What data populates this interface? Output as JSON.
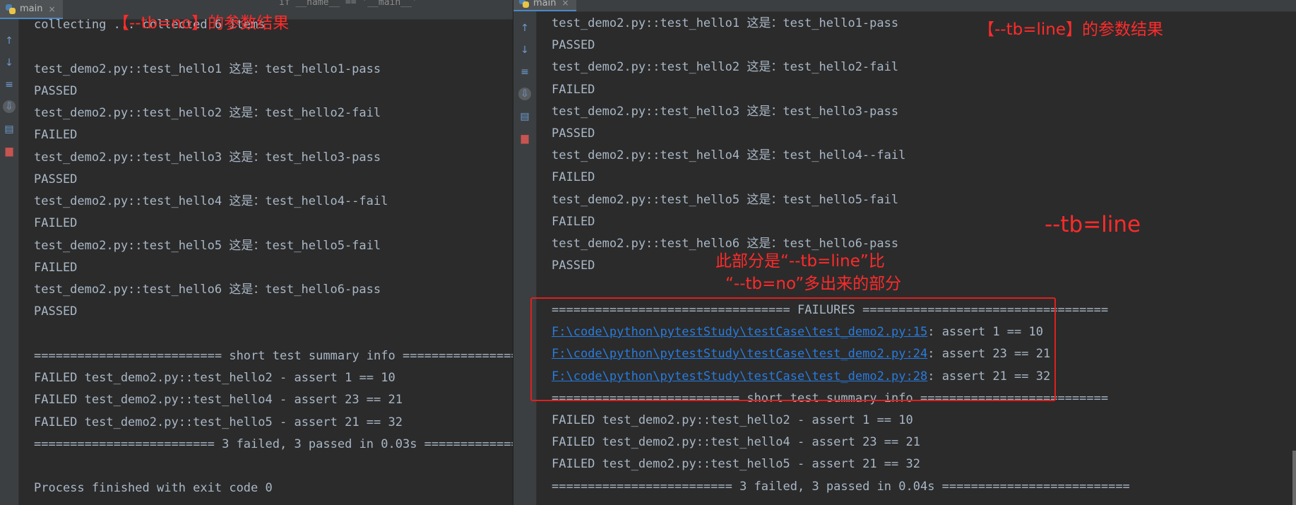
{
  "tab_label": "main",
  "tab_close": "×",
  "header_ghost": "if __name__ == '__main__'",
  "left": {
    "annotation": "【--tb=no】的参数结果",
    "lines": [
      "collecting ... collected 6 items",
      "",
      "test_demo2.py::test_hello1 这是：test_hello1-pass",
      "PASSED",
      "test_demo2.py::test_hello2 这是：test_hello2-fail",
      "FAILED",
      "test_demo2.py::test_hello3 这是：test_hello3-pass",
      "PASSED",
      "test_demo2.py::test_hello4 这是：test_hello4--fail",
      "FAILED",
      "test_demo2.py::test_hello5 这是：test_hello5-fail",
      "FAILED",
      "test_demo2.py::test_hello6 这是：test_hello6-pass",
      "PASSED",
      "",
      "========================== short test summary info ===========================",
      "FAILED test_demo2.py::test_hello2 - assert 1 == 10",
      "FAILED test_demo2.py::test_hello4 - assert 23 == 21",
      "FAILED test_demo2.py::test_hello5 - assert 21 == 32",
      "========================= 3 failed, 3 passed in 0.03s ==========================",
      "",
      "Process finished with exit code 0"
    ]
  },
  "right": {
    "annotation_title": "【--tb=line】的参数结果",
    "annotation_side": "--tb=line",
    "annotation_note_1": "此部分是“--tb=line”比",
    "annotation_note_2": "“--tb=no”多出来的部分",
    "lines_before": [
      "test_demo2.py::test_hello1 这是：test_hello1-pass",
      "PASSED",
      "test_demo2.py::test_hello2 这是：test_hello2-fail",
      "FAILED",
      "test_demo2.py::test_hello3 这是：test_hello3-pass",
      "PASSED",
      "test_demo2.py::test_hello4 这是：test_hello4--fail",
      "FAILED",
      "test_demo2.py::test_hello5 这是：test_hello5-fail",
      "FAILED",
      "test_demo2.py::test_hello6 这是：test_hello6-pass",
      "PASSED"
    ],
    "failures_header": "================================= FAILURES ==================================",
    "failures": [
      {
        "link": "F:\\code\\python\\pytestStudy\\testCase\\test_demo2.py:15",
        "text": ": assert 1 == 10"
      },
      {
        "link": "F:\\code\\python\\pytestStudy\\testCase\\test_demo2.py:24",
        "text": ": assert 23 == 21"
      },
      {
        "link": "F:\\code\\python\\pytestStudy\\testCase\\test_demo2.py:28",
        "text": ": assert 21 == 32"
      }
    ],
    "lines_after": [
      "========================== short test summary info ==========================",
      "FAILED test_demo2.py::test_hello2 - assert 1 == 10",
      "FAILED test_demo2.py::test_hello4 - assert 23 == 21",
      "FAILED test_demo2.py::test_hello5 - assert 21 == 32",
      "========================= 3 failed, 3 passed in 0.04s =========================="
    ]
  },
  "icons": [
    "python-file-icon",
    "up-arrow-icon",
    "down-arrow-icon",
    "soft-wrap-icon",
    "scroll-to-end-icon",
    "print-icon",
    "trash-icon"
  ],
  "colors": {
    "background": "#2b2b2b",
    "text": "#a9b7c6",
    "link": "#287bde",
    "annotation": "#ff2b2b"
  }
}
